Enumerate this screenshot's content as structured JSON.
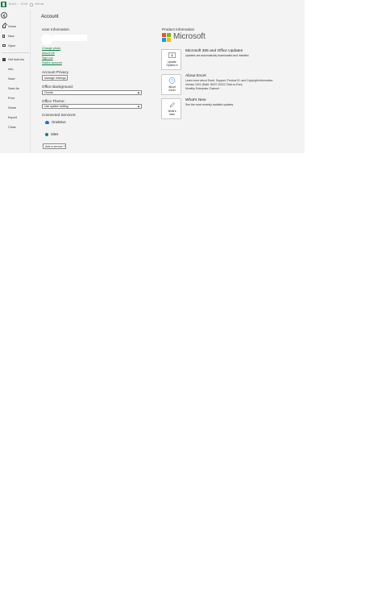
{
  "titlebar": {
    "app_name": "Book1",
    "separator": "•",
    "app_label": "Excel",
    "status": "Internal"
  },
  "sidebar": {
    "items": [
      {
        "key": "home",
        "label": "Home"
      },
      {
        "key": "new",
        "label": "New"
      },
      {
        "key": "open",
        "label": "Open"
      },
      {
        "key": "get-add-ins",
        "label": "Get Add-ins"
      },
      {
        "key": "info",
        "label": "Info"
      },
      {
        "key": "save",
        "label": "Save"
      },
      {
        "key": "save-as",
        "label": "Save As"
      },
      {
        "key": "print",
        "label": "Print"
      },
      {
        "key": "share",
        "label": "Share"
      },
      {
        "key": "export",
        "label": "Export"
      },
      {
        "key": "close",
        "label": "Close"
      }
    ]
  },
  "page": {
    "title": "Account"
  },
  "user_info": {
    "heading": "User Information",
    "links": {
      "change_photo": "Change photo",
      "about_me": "About me",
      "sign_out": "Sign out",
      "switch_account": "Switch account"
    }
  },
  "privacy": {
    "heading": "Account Privacy",
    "manage_button": "Manage Settings"
  },
  "background": {
    "heading": "Office Background:",
    "selected": "Clouds"
  },
  "theme": {
    "heading": "Office Theme:",
    "selected": "Use system setting"
  },
  "services": {
    "heading": "Connected Services:",
    "items": [
      "OneDrive",
      "Sites"
    ],
    "add_button": "Add a service"
  },
  "product": {
    "heading": "Product Information",
    "brand": "Microsoft",
    "brand_colors": [
      "#f25022",
      "#7fba00",
      "#00a4ef",
      "#ffb900"
    ],
    "updates": {
      "button_line1": "Update",
      "button_line2": "Options",
      "title": "Microsoft 365 and Office Updates",
      "text": "Updates are automatically downloaded and installed."
    },
    "about": {
      "button_line1": "About",
      "button_line2": "Excel",
      "title": "About Excel",
      "line1": "Learn more about Excel, Support, Product ID, and Copyright information.",
      "line2": "Version 2411 (Build 18227.20222 Click-to-Run)",
      "line3": "Monthly Enterprise Channel"
    },
    "whats_new": {
      "button_line1": "What's",
      "button_line2": "New",
      "title": "What's New",
      "text": "See the most recently installed updates."
    }
  },
  "colors": {
    "accent": "#107c41",
    "onedrive": "#0f78d4",
    "sites": "#05858a"
  }
}
